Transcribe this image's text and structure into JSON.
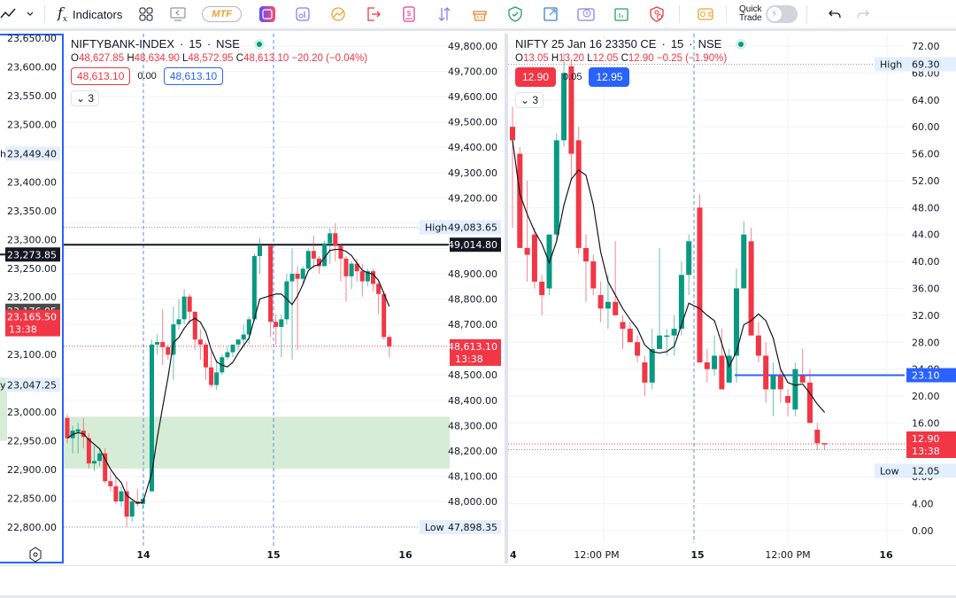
{
  "toolbar": {
    "indicators_label": "Indicators",
    "mtf_label": "MTF",
    "quick_trade_line1": "Quick",
    "quick_trade_line2": "Trade",
    "quick_trade_enabled": false,
    "icons": [
      "chart-style-icon",
      "chevron-down-icon",
      "fx-icon",
      "templates-icon",
      "replay-icon",
      "mtf-icon",
      "app-icon",
      "data-window-icon",
      "gift-icon",
      "exit-icon",
      "funds-icon",
      "sort-icon",
      "basket-icon",
      "shield-icon",
      "chart-resize-icon",
      "download-icon",
      "option-chain-icon",
      "alert-shield-icon",
      "wallet-icon",
      "quick-trade-toggle",
      "undo-icon",
      "redo-icon"
    ]
  },
  "left_scale": {
    "ticks": [
      "23,650.00",
      "23,600.00",
      "23,550.00",
      "23,500.00",
      "23,400.00",
      "23,350.00",
      "23,300.00",
      "23,250.00",
      "23,200.00",
      "23,100.00",
      "23,000.00",
      "22,950.00",
      "22,900.00",
      "22,850.00",
      "22,800.00"
    ],
    "high_label": "23,449.40",
    "line_label": "23,273.85",
    "prev_label": "23,176.05",
    "last_label": "23,165.50",
    "last_time": "13:38",
    "low_label": "23,047.25",
    "settings_icon": "settings-icon"
  },
  "chart1": {
    "symbol": "NIFTYBANK-INDEX",
    "interval": "15",
    "exchange": "NSE",
    "open": "48,627.85",
    "high": "48,634.90",
    "low": "48,572.95",
    "close": "48,613.10",
    "change": "−20.20 (−0.04%)",
    "sell_price": "48,613.10",
    "spread": "0.00",
    "buy_price": "48,613.10",
    "indicators_count": "3",
    "y_ticks": [
      "49,800.00",
      "49,700.00",
      "49,600.00",
      "49,500.00",
      "49,400.00",
      "49,300.00",
      "49,200.00",
      "48,900.00",
      "48,800.00",
      "48,700.00",
      "48,500.00",
      "48,400.00",
      "48,300.00",
      "48,200.00",
      "48,100.00",
      "48,000.00"
    ],
    "high_tag": "High",
    "high_value": "49,083.65",
    "line_value": "49,014.80",
    "last_value": "48,613.10",
    "last_time": "13:38",
    "low_tag": "Low",
    "low_value": "47,898.35",
    "x_ticks": [
      "14",
      "15",
      "16"
    ]
  },
  "chart2": {
    "symbol": "NIFTY 25 Jan 16 23350 CE",
    "interval": "15",
    "exchange": "NSE",
    "open": "13.05",
    "high": "13.20",
    "low": "12.05",
    "close": "12.90",
    "change": "−0.25 (−1.90%)",
    "sell_price": "12.90",
    "spread": "0.05",
    "buy_price": "12.95",
    "indicators_count": "3",
    "y_ticks": [
      "72.00",
      "68.00",
      "64.00",
      "60.00",
      "56.00",
      "52.00",
      "48.00",
      "44.00",
      "40.00",
      "36.00",
      "32.00",
      "28.00",
      "24.00",
      "20.00",
      "16.00",
      "8.00",
      "4.00",
      "0.00"
    ],
    "high_tag": "High",
    "high_value": "69.30",
    "line_value": "23.10",
    "last_value": "12.90",
    "last_time": "13:38",
    "low_tag": "Low",
    "low_value": "12.05",
    "x_ticks": [
      "4",
      "12:00 PM",
      "15",
      "12:00 PM",
      "16"
    ]
  },
  "colors": {
    "up": "#089981",
    "down": "#f23645",
    "accent": "#2962ff",
    "zone": "#d6ecd6"
  }
}
